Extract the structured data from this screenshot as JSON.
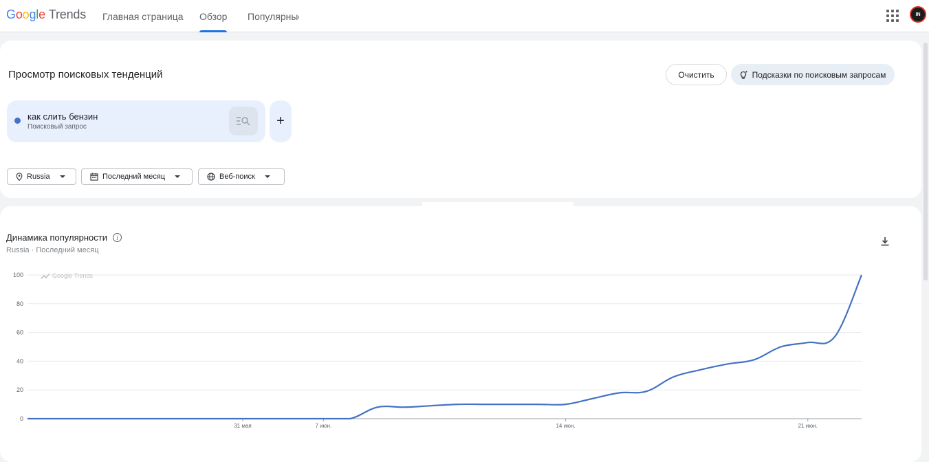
{
  "header": {
    "logo_google": "Google",
    "logo_product": "Trends",
    "tabs": [
      {
        "label": "Главная страница",
        "active": false
      },
      {
        "label": "Обзор",
        "active": true
      },
      {
        "label": "Популярные",
        "active": false
      }
    ],
    "avatar_text": "IN"
  },
  "explore": {
    "title": "Просмотр поисковых тенденций",
    "clear_label": "Очистить",
    "hints_label": "Подсказки по поисковым запросам",
    "term": {
      "name": "как слить бензин",
      "type": "Поисковый запрос",
      "color": "#4472c4"
    },
    "add_label": "+",
    "filters": [
      {
        "icon": "location-pin-icon",
        "label": "Russia"
      },
      {
        "icon": "calendar-icon",
        "label": "Последний месяц"
      },
      {
        "icon": "globe-icon",
        "label": "Веб-поиск"
      }
    ]
  },
  "interest": {
    "title": "Динамика популярности",
    "subtitle": "Russia · Последний месяц",
    "watermark": "Google Trends"
  },
  "chart_data": {
    "type": "line",
    "title": "Динамика популярности",
    "xlabel": "",
    "ylabel": "",
    "ylim": [
      0,
      100
    ],
    "yticks": [
      0,
      20,
      40,
      60,
      80,
      100
    ],
    "grid": true,
    "x_tick_labels": [
      {
        "label": "31 мая",
        "day": 8
      },
      {
        "label": "7 июн.",
        "day": 11
      },
      {
        "label": "14 июн.",
        "day": 20
      },
      {
        "label": "21 июн.",
        "day": 29
      }
    ],
    "series": [
      {
        "name": "как слить бензин",
        "color": "#4472c4",
        "x": [
          0,
          1,
          2,
          3,
          4,
          5,
          6,
          7,
          8,
          9,
          10,
          11,
          12,
          13,
          14,
          15,
          16,
          17,
          18,
          19,
          20,
          21,
          22,
          23,
          24,
          25,
          26,
          27,
          28,
          29,
          30,
          31
        ],
        "values": [
          0,
          0,
          0,
          0,
          0,
          0,
          0,
          0,
          0,
          0,
          0,
          0,
          0,
          8,
          8,
          9,
          10,
          10,
          10,
          10,
          10,
          14,
          18,
          19,
          29,
          34,
          38,
          41,
          50,
          53,
          57,
          100
        ]
      }
    ]
  }
}
